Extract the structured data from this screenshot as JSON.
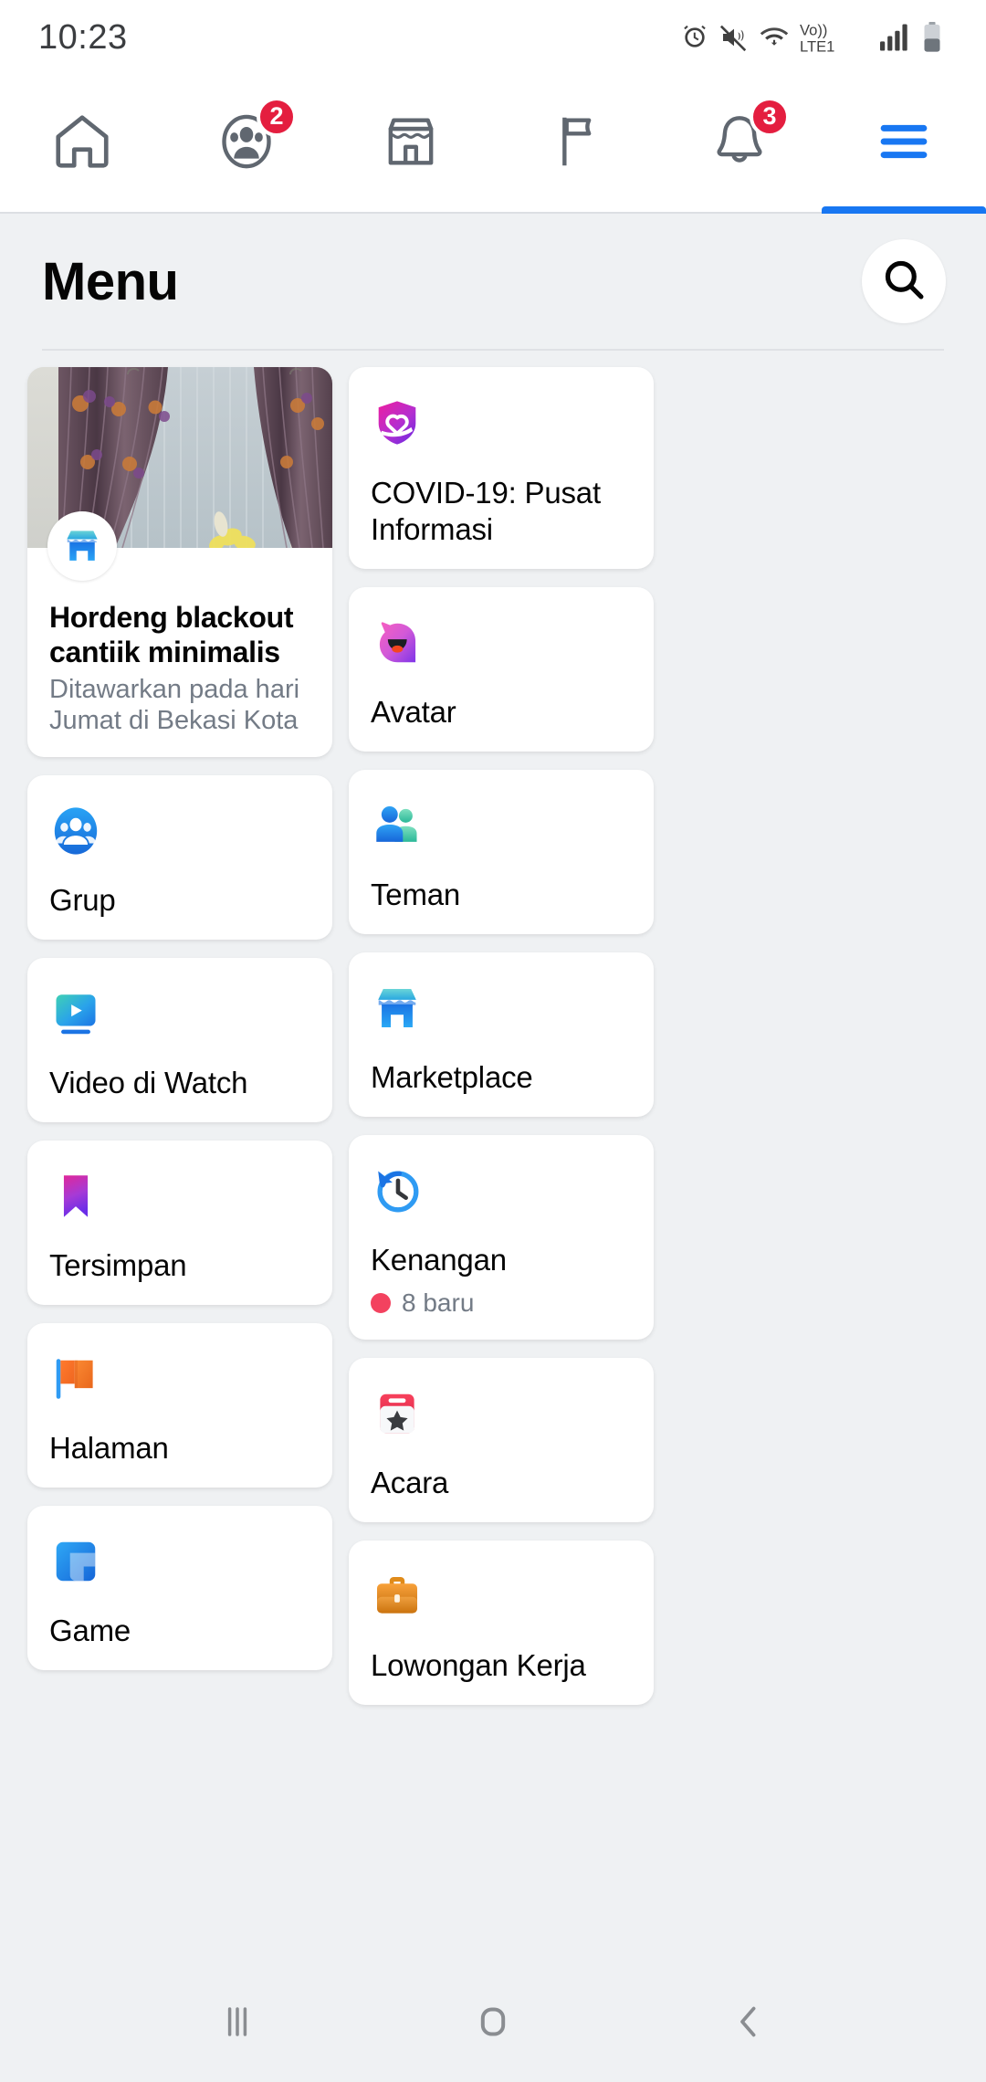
{
  "status_bar": {
    "time": "10:23",
    "icons": [
      "alarm-icon",
      "mute-icon",
      "wifi-icon",
      "volte-lte1-icon",
      "signal-icon",
      "battery-icon"
    ],
    "network_label": "Vo))",
    "network_label2": "LTE1"
  },
  "tabbar": {
    "tabs": [
      {
        "name": "home",
        "icon": "home-icon",
        "badge": ""
      },
      {
        "name": "friends",
        "icon": "friends-icon",
        "badge": "2"
      },
      {
        "name": "marketplace",
        "icon": "store-icon",
        "badge": ""
      },
      {
        "name": "pages",
        "icon": "flag-icon",
        "badge": ""
      },
      {
        "name": "notifications",
        "icon": "bell-icon",
        "badge": "3"
      },
      {
        "name": "menu",
        "icon": "hamburger-icon",
        "badge": "",
        "active": true
      }
    ]
  },
  "header": {
    "title": "Menu",
    "search_icon": "search-icon"
  },
  "listing": {
    "icon": "marketplace-badge-icon",
    "title": "Hordeng blackout cantiik minimalis",
    "subtitle": "Ditawarkan pada hari Jumat di Bekasi Kota"
  },
  "left_column": [
    {
      "icon": "groups-icon",
      "label": "Grup"
    },
    {
      "icon": "watch-icon",
      "label": "Video di Watch"
    },
    {
      "icon": "bookmark-icon",
      "label": "Tersimpan"
    },
    {
      "icon": "flag-icon",
      "label": "Halaman"
    },
    {
      "icon": "game-icon",
      "label": "Game"
    }
  ],
  "right_column": [
    {
      "icon": "covid-shield-icon",
      "label": "COVID-19: Pusat Informasi"
    },
    {
      "icon": "avatar-icon",
      "label": "Avatar"
    },
    {
      "icon": "friends-icon",
      "label": "Teman"
    },
    {
      "icon": "marketplace-icon",
      "label": "Marketplace"
    },
    {
      "icon": "memories-clock-icon",
      "label": "Kenangan",
      "meta": "8 baru",
      "meta_dot_color": "#f3425f"
    },
    {
      "icon": "calendar-star-icon",
      "label": "Acara"
    },
    {
      "icon": "briefcase-icon",
      "label": "Lowongan Kerja"
    }
  ],
  "navbar": {
    "buttons": [
      {
        "name": "recents-button",
        "icon": "recents-icon"
      },
      {
        "name": "home-button",
        "icon": "home-square-icon"
      },
      {
        "name": "back-button",
        "icon": "back-chevron-icon"
      }
    ]
  },
  "colors": {
    "accent": "#1877f2",
    "badge_red": "#e41e3f",
    "page_bg": "#eff1f3",
    "card_bg": "#ffffff",
    "text_primary": "#050505",
    "text_secondary": "#737b86"
  }
}
